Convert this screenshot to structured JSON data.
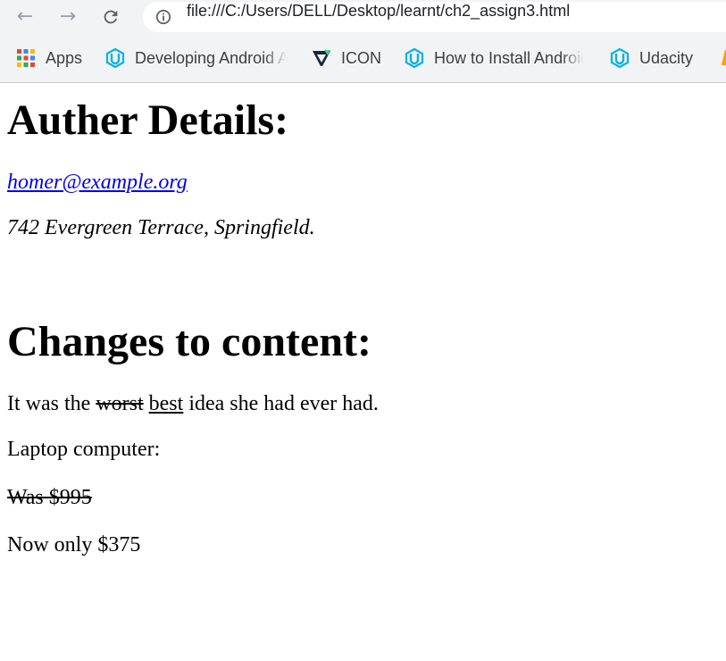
{
  "browser": {
    "url": "file:///C:/Users/DELL/Desktop/learnt/ch2_assign3.html",
    "bookmarks": [
      {
        "label": "Apps",
        "icon": "apps-grid-icon"
      },
      {
        "label": "Developing Android A",
        "icon": "udacity-icon"
      },
      {
        "label": "ICON",
        "icon": "v-logo-icon"
      },
      {
        "label": "How to Install Android",
        "icon": "udacity-icon"
      },
      {
        "label": "Udacity",
        "icon": "udacity-icon"
      }
    ]
  },
  "page": {
    "author_heading": "Auther Details:",
    "email": "homer@example.org",
    "address": "742 Evergreen Terrace, Springfield.",
    "changes_heading": "Changes to content:",
    "sentence": {
      "before": "It was the",
      "deleted": "worst",
      "inserted": "best",
      "after": "idea she had ever had."
    },
    "product": "Laptop computer:",
    "old_price": "Was $995",
    "new_price": "Now only $375"
  }
}
